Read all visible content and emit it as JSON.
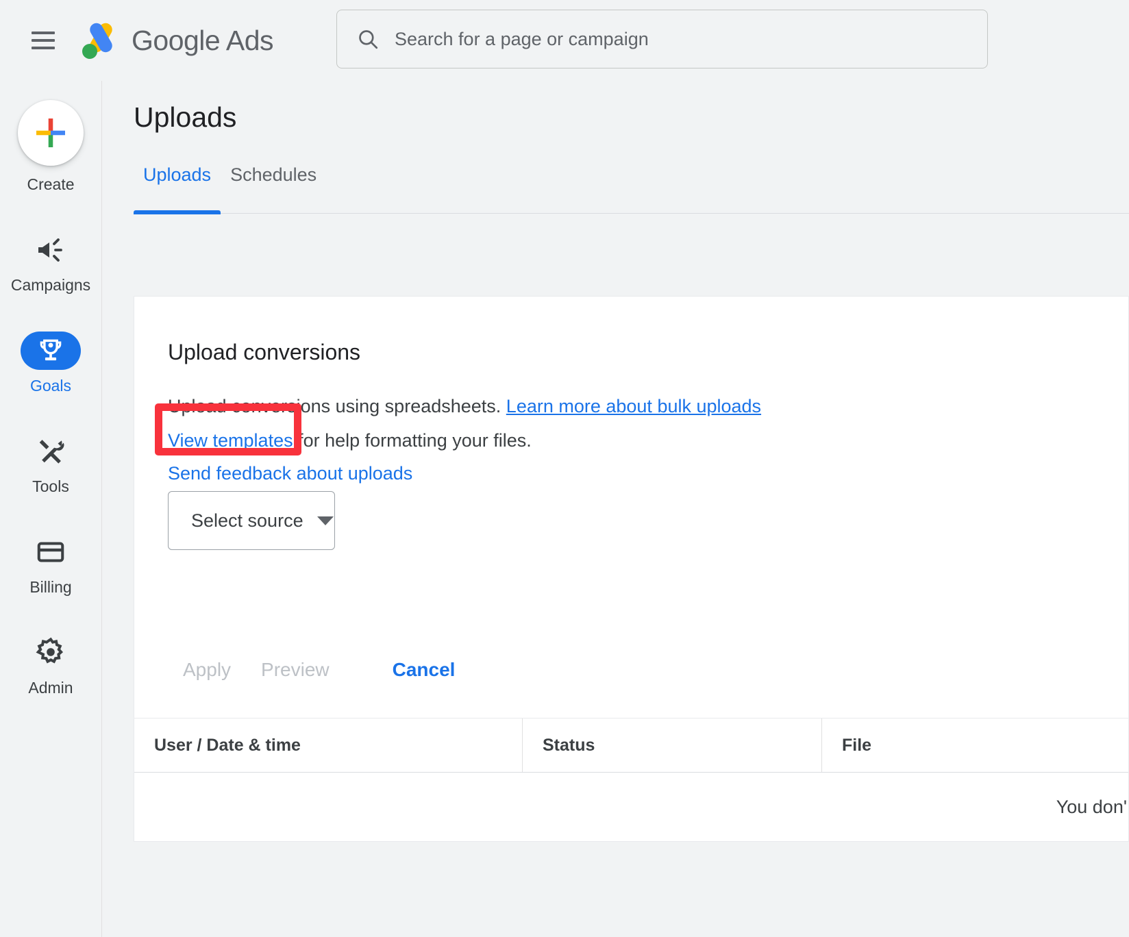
{
  "header": {
    "menu_icon": "hamburger-menu-icon",
    "brand_primary": "Google",
    "brand_secondary": "Ads",
    "search": {
      "icon": "search-icon",
      "placeholder": "Search for a page or campaign",
      "value": ""
    }
  },
  "sidebar": {
    "create": {
      "label": "Create",
      "icon": "plus-icon"
    },
    "items": [
      {
        "label": "Campaigns",
        "icon": "megaphone-icon",
        "active": false
      },
      {
        "label": "Goals",
        "icon": "trophy-icon",
        "active": true
      },
      {
        "label": "Tools",
        "icon": "tools-icon",
        "active": false
      },
      {
        "label": "Billing",
        "icon": "credit-card-icon",
        "active": false
      },
      {
        "label": "Admin",
        "icon": "gear-icon",
        "active": false
      }
    ]
  },
  "main": {
    "page_title": "Uploads",
    "tabs": [
      {
        "label": "Uploads",
        "active": true
      },
      {
        "label": "Schedules",
        "active": false
      }
    ],
    "card": {
      "title": "Upload conversions",
      "line1_text": "Upload conversions using spreadsheets. ",
      "line1_link": "Learn more about bulk uploads",
      "line2_link": "View templates",
      "line2_text": " for help formatting your files.",
      "line3_link": "Send feedback about uploads",
      "select_source": {
        "label": "Select source",
        "caret_icon": "chevron-down-icon"
      },
      "actions": {
        "apply": "Apply",
        "preview": "Preview",
        "cancel": "Cancel"
      }
    },
    "table": {
      "columns": [
        "User / Date & time",
        "Status",
        "File"
      ],
      "empty_message": "You don'"
    }
  },
  "annotation": {
    "highlight_color": "#f8323c",
    "highlight_target": "View templates"
  },
  "colors": {
    "accent_blue": "#1a73e8",
    "page_bg": "#f1f3f4",
    "card_bg": "#ffffff",
    "text_primary": "#202124",
    "text_secondary": "#5f6368",
    "disabled": "#bdc1c6",
    "google_blue": "#4285f4",
    "google_red": "#ea4335",
    "google_yellow": "#fbbc04",
    "google_green": "#34a853"
  }
}
